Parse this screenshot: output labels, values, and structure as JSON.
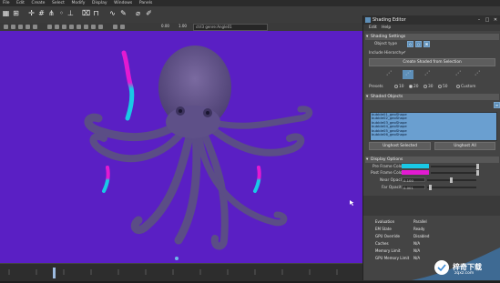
{
  "app": {
    "menu": [
      "File",
      "Edit",
      "Create",
      "Select",
      "Modify",
      "Display",
      "Windows",
      "Panels"
    ]
  },
  "viewport": {
    "camera_field": "ctrl3 genre:Angle01",
    "frame_value": "0.00",
    "frame_value2": "1.00",
    "background_color": "#5a1fc4"
  },
  "editor": {
    "title": "Shading Editor",
    "menu": [
      "Edit",
      "Help"
    ],
    "settings_section": "Shading Settings",
    "object_type_label": "Object type",
    "include_hierarchy_label": "Include Hierarchy",
    "create_button": "Create Shaded from Selection",
    "presets_label": "Presets",
    "preset_options": [
      "10",
      "20",
      "30",
      "50",
      "Custom"
    ],
    "shaded_objects_section": "Shaded Objects",
    "objects": [
      "bubble01_geoShape",
      "bubble02_geoShape",
      "bubble03_geoShape",
      "bubble04_geoShape",
      "bubble05_geoShape",
      "bubble06_geoShape"
    ],
    "unghost_selected": "Unghost Selected",
    "unghost_all": "Unghost All",
    "display_section": "Display Options",
    "pre_frame_color_label": "Pre Frame Color",
    "post_frame_color_label": "Post Frame Color",
    "pre_frame_color": "#19c9e6",
    "post_frame_color": "#e31ad1",
    "near_opacity_label": "Near Opacity",
    "near_opacity_value": "0.100",
    "far_opacity_label": "Far Opacity",
    "far_opacity_value": "0.001"
  },
  "hud": [
    {
      "key": "Evaluation",
      "value": "Parallel"
    },
    {
      "key": "EM State",
      "value": "Ready"
    },
    {
      "key": "GPU Override",
      "value": "Disabled"
    },
    {
      "key": "Caches",
      "value": "N/A"
    },
    {
      "key": "Memory Limit",
      "value": "N/A"
    },
    {
      "key": "GPU Memory Limit",
      "value": "N/A"
    }
  ],
  "watermark": {
    "text": "梓奇下载",
    "url": "zqxz.com"
  }
}
